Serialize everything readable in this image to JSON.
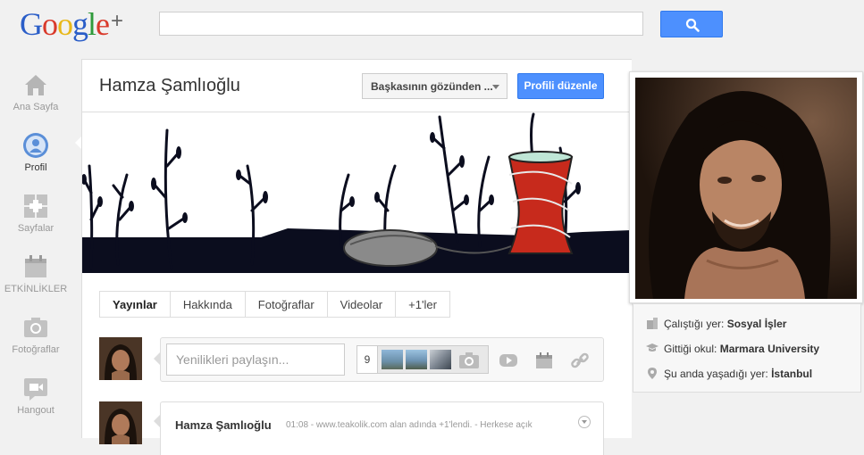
{
  "header": {
    "logo_letters": [
      "G",
      "o",
      "o",
      "g",
      "l",
      "e"
    ],
    "logo_plus": "+",
    "search_placeholder": "",
    "brand_colors": {
      "blue": "#2b5ec8",
      "red": "#d93a2b",
      "yellow": "#e8b81a",
      "green": "#2f9a3b",
      "action_blue": "#4d90fe"
    }
  },
  "sidenav": {
    "items": [
      {
        "label": "Ana Sayfa",
        "icon": "home-icon",
        "active": false
      },
      {
        "label": "Profil",
        "icon": "profile-icon",
        "active": true
      },
      {
        "label": "Sayfalar",
        "icon": "pages-icon",
        "active": false
      },
      {
        "label": "ETKİNLİKLER",
        "icon": "calendar-icon",
        "active": false
      },
      {
        "label": "Fotoğraflar",
        "icon": "camera-icon",
        "active": false
      },
      {
        "label": "Hangout",
        "icon": "video-icon",
        "active": false
      }
    ]
  },
  "profile": {
    "name": "Hamza Şamlıoğlu",
    "view_as": "Başkasının gözünden ...",
    "edit_button": "Profili düzenle"
  },
  "tabs": [
    "Yayınlar",
    "Hakkında",
    "Fotoğraflar",
    "Videolar",
    "+1'ler"
  ],
  "share": {
    "placeholder": "Yenilikleri paylaşın...",
    "photo_count": "9",
    "tools": [
      "camera-icon",
      "video-icon",
      "event-icon",
      "link-icon"
    ]
  },
  "post": {
    "author": "Hamza Şamlıoğlu",
    "meta": "01:08  -  www.teakolik.com alan adında +1'lendi.  -  Herkese açık"
  },
  "about": {
    "work_label": "Çalıştığı yer:",
    "work_value": "Sosyal İşler",
    "school_label": "Gittiği okul:",
    "school_value": "Marmara University",
    "lives_label": "Şu anda yaşadığı yer:",
    "lives_value": "İstanbul"
  }
}
